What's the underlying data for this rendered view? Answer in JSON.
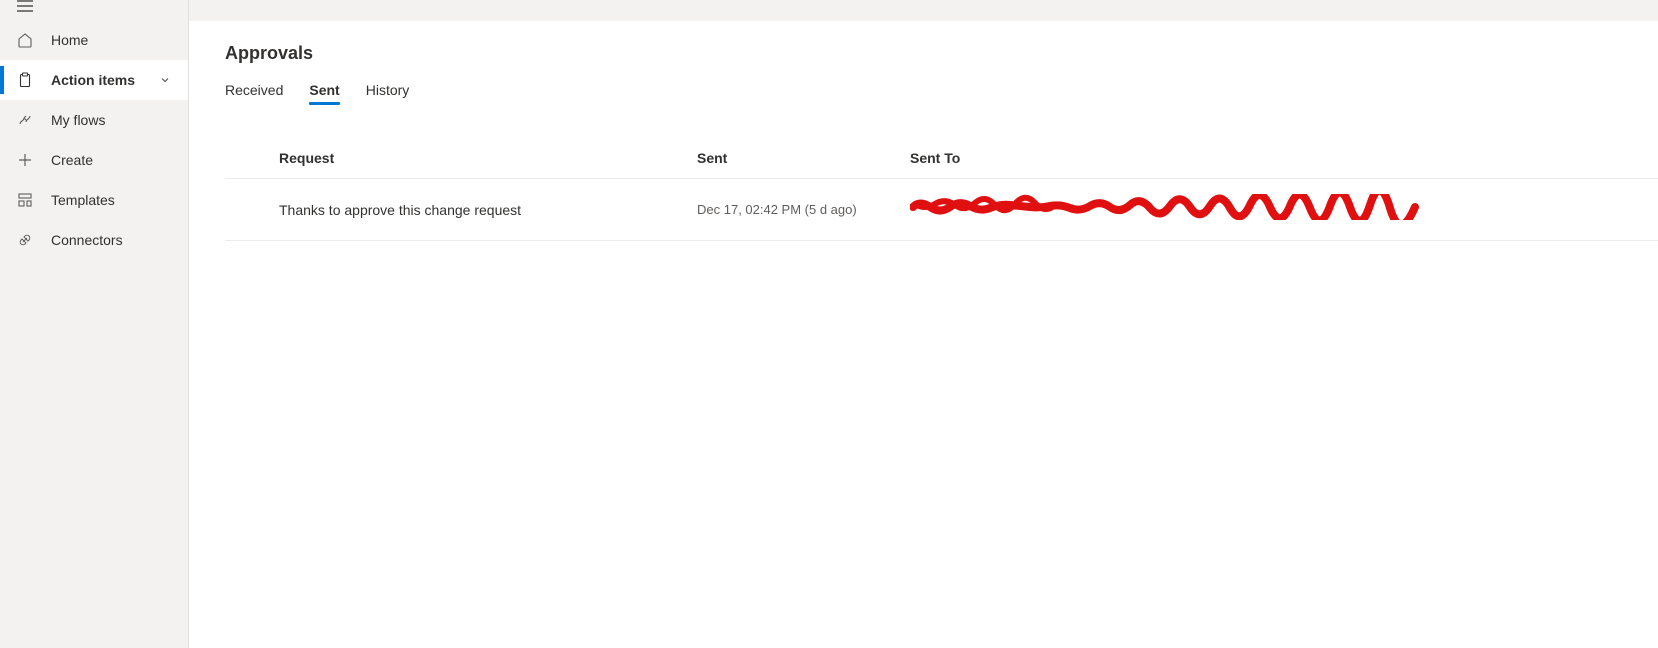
{
  "sidebar": {
    "items": [
      {
        "label": "Home"
      },
      {
        "label": "Action items"
      },
      {
        "label": "My flows"
      },
      {
        "label": "Create"
      },
      {
        "label": "Templates"
      },
      {
        "label": "Connectors"
      }
    ]
  },
  "page": {
    "title": "Approvals"
  },
  "tabs": [
    {
      "label": "Received"
    },
    {
      "label": "Sent"
    },
    {
      "label": "History"
    }
  ],
  "table": {
    "headers": {
      "request": "Request",
      "sent": "Sent",
      "sent_to": "Sent To"
    },
    "rows": [
      {
        "request": "Thanks to approve this change request",
        "sent": "Dec 17, 02:42 PM (5 d ago)",
        "sent_to": "[redacted]"
      }
    ]
  }
}
